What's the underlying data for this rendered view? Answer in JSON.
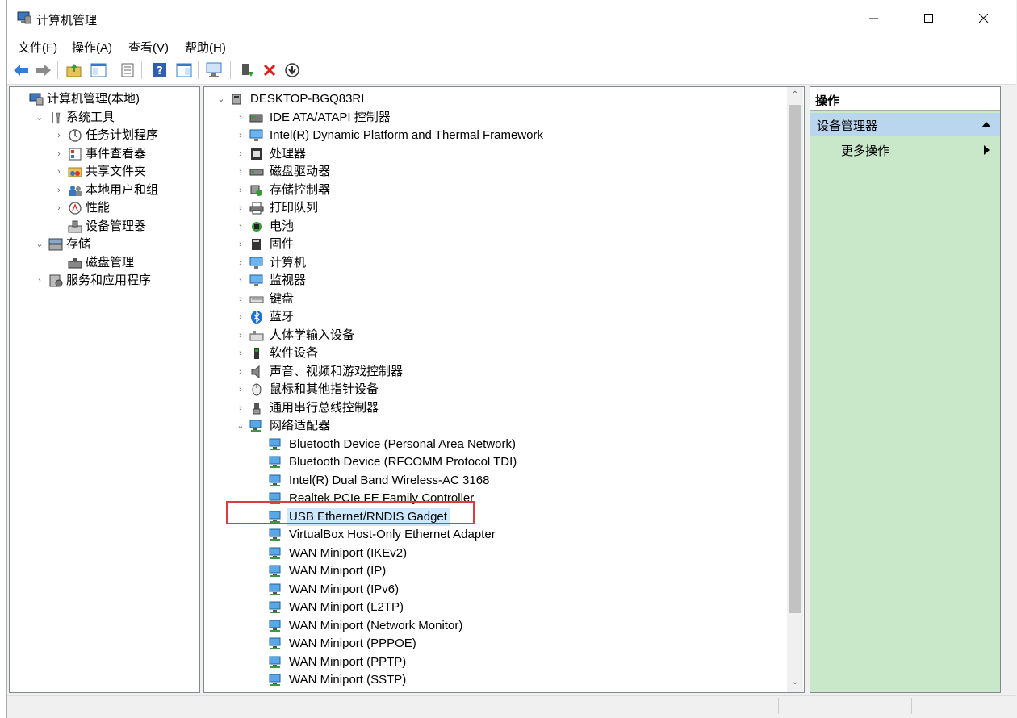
{
  "window": {
    "title": "计算机管理"
  },
  "menu": [
    "文件(F)",
    "操作(A)",
    "查看(V)",
    "帮助(H)"
  ],
  "left_tree": [
    {
      "label": "计算机管理(本地)",
      "icon": "computer-management-icon",
      "level": 0,
      "expander": ""
    },
    {
      "label": "系统工具",
      "icon": "tools-icon",
      "level": 1,
      "expander": "v"
    },
    {
      "label": "任务计划程序",
      "icon": "clock-icon",
      "level": 2,
      "expander": ">"
    },
    {
      "label": "事件查看器",
      "icon": "event-viewer-icon",
      "level": 2,
      "expander": ">"
    },
    {
      "label": "共享文件夹",
      "icon": "shared-folder-icon",
      "level": 2,
      "expander": ">"
    },
    {
      "label": "本地用户和组",
      "icon": "users-icon",
      "level": 2,
      "expander": ">"
    },
    {
      "label": "性能",
      "icon": "performance-icon",
      "level": 2,
      "expander": ">"
    },
    {
      "label": "设备管理器",
      "icon": "device-manager-icon",
      "level": 2,
      "expander": "",
      "selected": true
    },
    {
      "label": "存储",
      "icon": "storage-icon",
      "level": 1,
      "expander": "v"
    },
    {
      "label": "磁盘管理",
      "icon": "disk-management-icon",
      "level": 2,
      "expander": ""
    },
    {
      "label": "服务和应用程序",
      "icon": "services-icon",
      "level": 1,
      "expander": ">"
    }
  ],
  "device_tree": [
    {
      "label": "DESKTOP-BGQ83RI",
      "icon": "computer-root-icon",
      "level": 0,
      "expander": "v"
    },
    {
      "label": "IDE ATA/ATAPI 控制器",
      "icon": "ide-controller-icon",
      "level": 1,
      "expander": ">"
    },
    {
      "label": "Intel(R) Dynamic Platform and Thermal Framework",
      "icon": "monitor-icon",
      "level": 1,
      "expander": ">"
    },
    {
      "label": "处理器",
      "icon": "processor-icon",
      "level": 1,
      "expander": ">"
    },
    {
      "label": "磁盘驱动器",
      "icon": "disk-drive-icon",
      "level": 1,
      "expander": ">"
    },
    {
      "label": "存储控制器",
      "icon": "storage-controller-icon",
      "level": 1,
      "expander": ">"
    },
    {
      "label": "打印队列",
      "icon": "printer-icon",
      "level": 1,
      "expander": ">"
    },
    {
      "label": "电池",
      "icon": "battery-icon",
      "level": 1,
      "expander": ">"
    },
    {
      "label": "固件",
      "icon": "firmware-icon",
      "level": 1,
      "expander": ">"
    },
    {
      "label": "计算机",
      "icon": "monitor-icon",
      "level": 1,
      "expander": ">"
    },
    {
      "label": "监视器",
      "icon": "monitor-icon",
      "level": 1,
      "expander": ">"
    },
    {
      "label": "键盘",
      "icon": "keyboard-icon",
      "level": 1,
      "expander": ">"
    },
    {
      "label": "蓝牙",
      "icon": "bluetooth-icon",
      "level": 1,
      "expander": ">"
    },
    {
      "label": "人体学输入设备",
      "icon": "hid-icon",
      "level": 1,
      "expander": ">"
    },
    {
      "label": "软件设备",
      "icon": "software-device-icon",
      "level": 1,
      "expander": ">"
    },
    {
      "label": "声音、视频和游戏控制器",
      "icon": "speaker-icon",
      "level": 1,
      "expander": ">"
    },
    {
      "label": "鼠标和其他指针设备",
      "icon": "mouse-icon",
      "level": 1,
      "expander": ">"
    },
    {
      "label": "通用串行总线控制器",
      "icon": "usb-icon",
      "level": 1,
      "expander": ">"
    },
    {
      "label": "网络适配器",
      "icon": "network-adapter-icon",
      "level": 1,
      "expander": "v"
    },
    {
      "label": "Bluetooth Device (Personal Area Network)",
      "icon": "network-adapter-icon",
      "level": 2,
      "expander": ""
    },
    {
      "label": "Bluetooth Device (RFCOMM Protocol TDI)",
      "icon": "network-adapter-icon",
      "level": 2,
      "expander": ""
    },
    {
      "label": "Intel(R) Dual Band Wireless-AC 3168",
      "icon": "network-adapter-icon",
      "level": 2,
      "expander": ""
    },
    {
      "label": "Realtek PCIe FE Family Controller",
      "icon": "network-adapter-icon",
      "level": 2,
      "expander": ""
    },
    {
      "label": "USB Ethernet/RNDIS Gadget",
      "icon": "network-adapter-icon",
      "level": 2,
      "expander": "",
      "highlighted": true
    },
    {
      "label": "VirtualBox Host-Only Ethernet Adapter",
      "icon": "network-adapter-icon",
      "level": 2,
      "expander": ""
    },
    {
      "label": "WAN Miniport (IKEv2)",
      "icon": "network-adapter-icon",
      "level": 2,
      "expander": ""
    },
    {
      "label": "WAN Miniport (IP)",
      "icon": "network-adapter-icon",
      "level": 2,
      "expander": ""
    },
    {
      "label": "WAN Miniport (IPv6)",
      "icon": "network-adapter-icon",
      "level": 2,
      "expander": ""
    },
    {
      "label": "WAN Miniport (L2TP)",
      "icon": "network-adapter-icon",
      "level": 2,
      "expander": ""
    },
    {
      "label": "WAN Miniport (Network Monitor)",
      "icon": "network-adapter-icon",
      "level": 2,
      "expander": ""
    },
    {
      "label": "WAN Miniport (PPPOE)",
      "icon": "network-adapter-icon",
      "level": 2,
      "expander": ""
    },
    {
      "label": "WAN Miniport (PPTP)",
      "icon": "network-adapter-icon",
      "level": 2,
      "expander": ""
    },
    {
      "label": "WAN Miniport (SSTP)",
      "icon": "network-adapter-icon",
      "level": 2,
      "expander": ""
    }
  ],
  "actions": {
    "header": "操作",
    "section": "设备管理器",
    "more": "更多操作"
  },
  "colors": {
    "accent": "#cce8ff",
    "actions_bg": "#c9e7c9",
    "annotation": "#e0393e"
  }
}
